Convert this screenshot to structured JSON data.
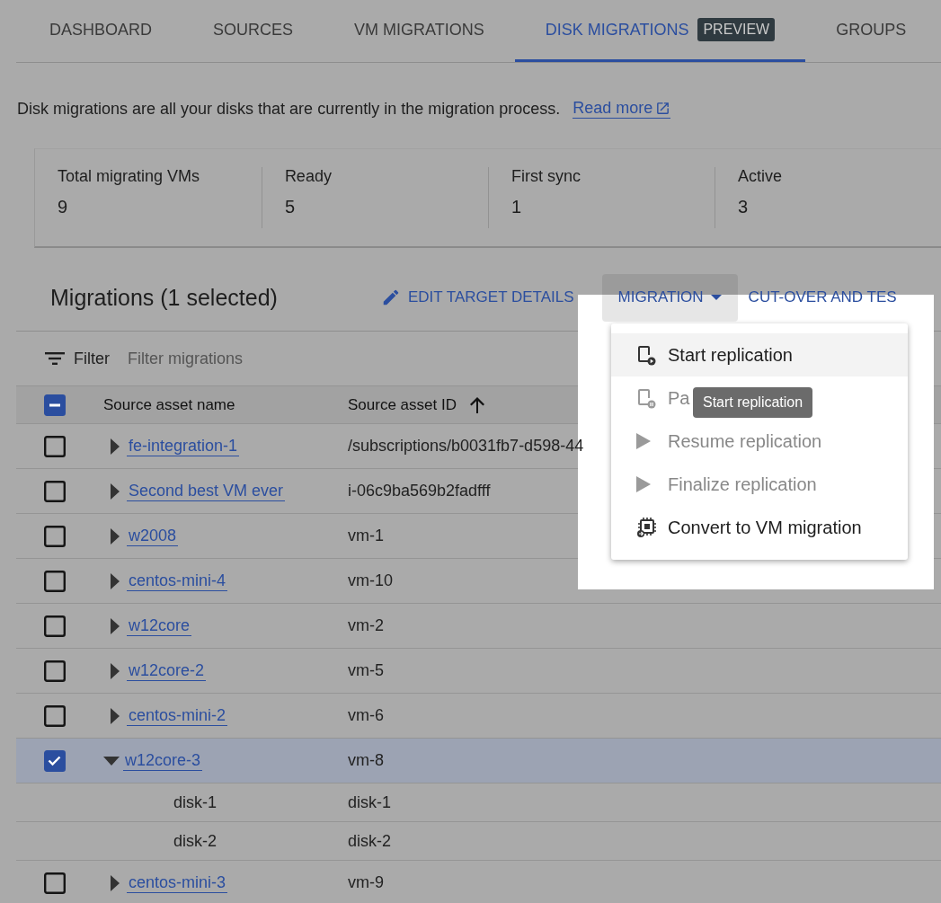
{
  "tabs": [
    {
      "label": "DASHBOARD",
      "selected": false
    },
    {
      "label": "SOURCES",
      "selected": false
    },
    {
      "label": "VM MIGRATIONS",
      "selected": false
    },
    {
      "label": "DISK MIGRATIONS",
      "selected": true,
      "badge": "PREVIEW"
    },
    {
      "label": "GROUPS",
      "selected": false
    }
  ],
  "description": {
    "text": "Disk migrations are all your disks that are currently in the migration process.",
    "link": "Read more"
  },
  "stats": [
    {
      "label": "Total migrating VMs",
      "value": "9"
    },
    {
      "label": "Ready",
      "value": "5"
    },
    {
      "label": "First sync",
      "value": "1"
    },
    {
      "label": "Active",
      "value": "3"
    }
  ],
  "toolbar": {
    "title": "Migrations (1 selected)",
    "actions": [
      {
        "label": "EDIT TARGET DETAILS",
        "kind": "edit",
        "open": false
      },
      {
        "label": "MIGRATION",
        "kind": "dropdown",
        "open": true
      },
      {
        "label": "CUT-OVER AND TES",
        "kind": "plain",
        "open": false
      }
    ]
  },
  "filter": {
    "label": "Filter",
    "placeholder": "Filter migrations"
  },
  "table": {
    "select_all": {
      "indeterminate": true
    },
    "columns": [
      {
        "label": "Source asset name",
        "sorted": false
      },
      {
        "label": "Source asset ID",
        "sorted": true
      }
    ],
    "rows": [
      {
        "name": "fe-integration-1",
        "id": "/subscriptions/b0031fb7-d598-44",
        "checked": false,
        "expanded": false
      },
      {
        "name": "Second best VM ever",
        "id": "i-06c9ba569b2fadfff",
        "checked": false,
        "expanded": false
      },
      {
        "name": "w2008",
        "id": "vm-1",
        "checked": false,
        "expanded": false
      },
      {
        "name": "centos-mini-4",
        "id": "vm-10",
        "checked": false,
        "expanded": false
      },
      {
        "name": "w12core",
        "id": "vm-2",
        "checked": false,
        "expanded": false
      },
      {
        "name": "w12core-2",
        "id": "vm-5",
        "checked": false,
        "expanded": false
      },
      {
        "name": "centos-mini-2",
        "id": "vm-6",
        "checked": false,
        "expanded": false
      },
      {
        "name": "w12core-3",
        "id": "vm-8",
        "checked": true,
        "expanded": true,
        "children": [
          {
            "name": "disk-1",
            "id": "disk-1"
          },
          {
            "name": "disk-2",
            "id": "disk-2"
          }
        ]
      },
      {
        "name": "centos-mini-3",
        "id": "vm-9",
        "checked": false,
        "expanded": false
      }
    ]
  },
  "menu": {
    "items": [
      {
        "label": "Start replication",
        "kind": "start",
        "disabled": false,
        "selected": true
      },
      {
        "label": "Pa",
        "kind": "pause",
        "disabled": true,
        "selected": false
      },
      {
        "label": "Resume replication",
        "kind": "resume",
        "disabled": true,
        "selected": false
      },
      {
        "label": "Finalize replication",
        "kind": "finalize",
        "disabled": true,
        "selected": false
      },
      {
        "label": "Convert to VM migration",
        "kind": "convert",
        "disabled": false,
        "selected": false
      }
    ]
  },
  "tooltip": "Start replication"
}
